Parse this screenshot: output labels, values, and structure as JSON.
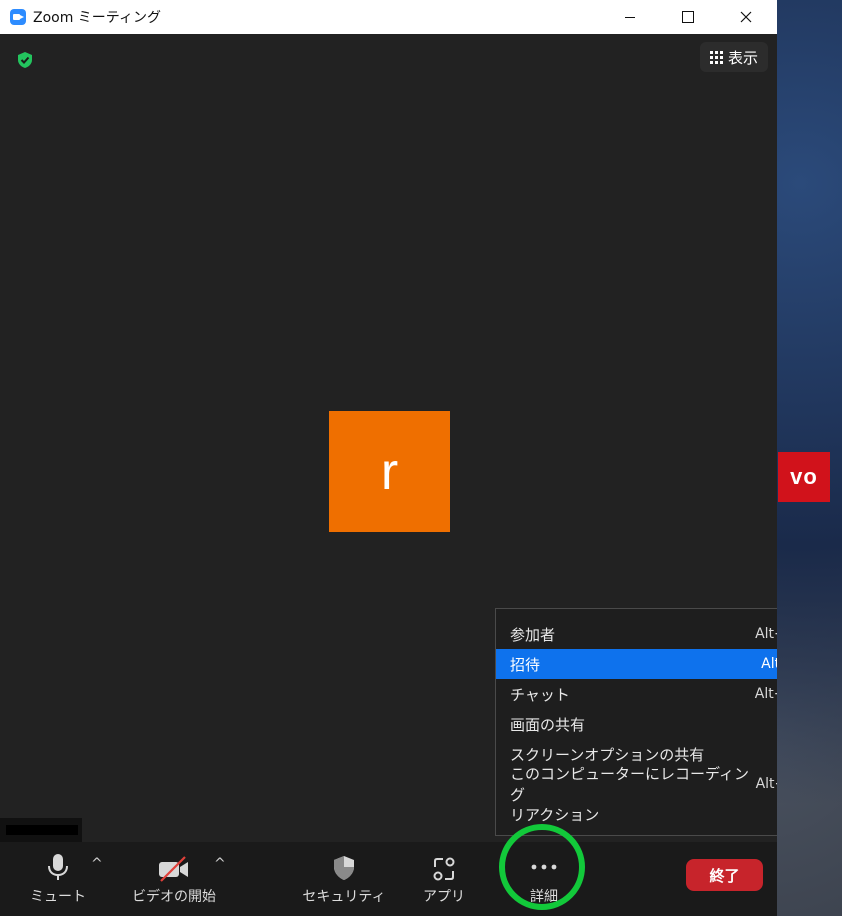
{
  "window": {
    "title": "Zoom ミーティング"
  },
  "controls": {
    "minimize": "—",
    "maximize": "☐",
    "close": "✕"
  },
  "top_right": {
    "view_label": "表示"
  },
  "participant": {
    "initial": "r"
  },
  "desktop": {
    "brand_text": "vo",
    "brand_color": "#d1121b"
  },
  "menu": {
    "items": [
      {
        "label": "参加者",
        "shortcut": "Alt+U",
        "active": false
      },
      {
        "label": "招待",
        "shortcut": "Alt+I",
        "active": true
      },
      {
        "label": "チャット",
        "shortcut": "Alt+H",
        "active": false
      },
      {
        "label": "画面の共有",
        "shortcut": "",
        "active": false
      },
      {
        "label": "スクリーンオプションの共有",
        "shortcut": "",
        "active": false
      },
      {
        "label": "このコンピューターにレコーディング",
        "shortcut": "Alt+R",
        "active": false
      },
      {
        "label": "リアクション",
        "shortcut": "",
        "active": false
      }
    ]
  },
  "toolbar": {
    "mute_label": "ミュート",
    "video_label": "ビデオの開始",
    "security_label": "セキュリティ",
    "apps_label": "アプリ",
    "more_label": "詳細",
    "end_label": "終了",
    "caret": "^"
  },
  "colors": {
    "accent": "#0e72ed",
    "avatar": "#ef6f00",
    "end_button": "#c7242b",
    "highlight": "#12c93a",
    "shield": "#23c45e"
  }
}
